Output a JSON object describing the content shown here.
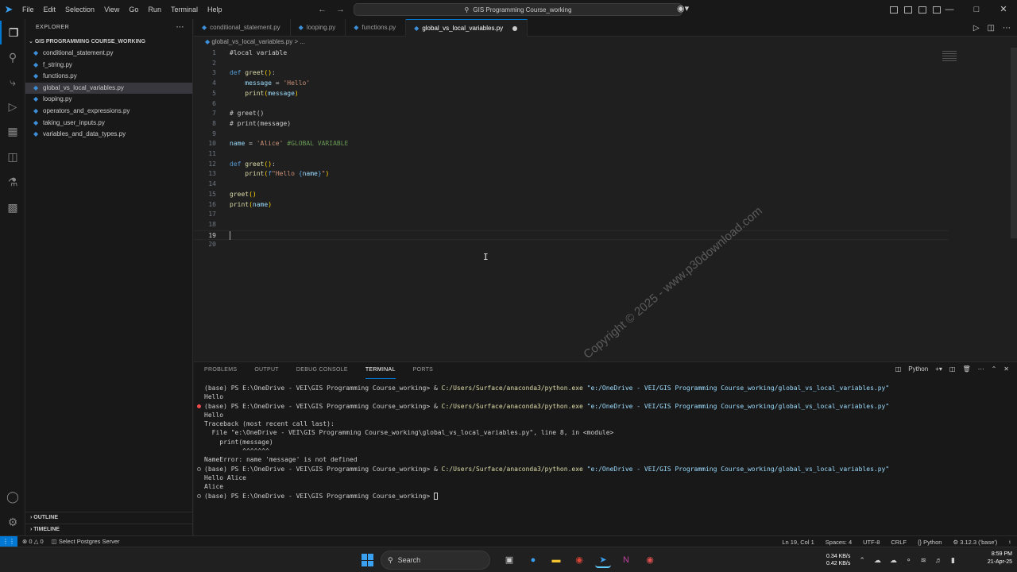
{
  "titlebar": {
    "menu": [
      "File",
      "Edit",
      "Selection",
      "View",
      "Go",
      "Run",
      "Terminal",
      "Help"
    ],
    "search": "GIS Programming Course_working"
  },
  "sidebar": {
    "header": "EXPLORER",
    "folder": "GIS PROGRAMMING COURSE_WORKING",
    "files": [
      "conditional_statement.py",
      "f_string.py",
      "functions.py",
      "global_vs_local_variables.py",
      "looping.py",
      "operators_and_expressions.py",
      "taking_user_inputs.py",
      "variables_and_data_types.py"
    ],
    "selected_index": 3,
    "outline": "OUTLINE",
    "timeline": "TIMELINE"
  },
  "tabs": [
    {
      "label": "conditional_statement.py",
      "active": false
    },
    {
      "label": "looping.py",
      "active": false
    },
    {
      "label": "functions.py",
      "active": false
    },
    {
      "label": "global_vs_local_variables.py",
      "active": true,
      "modified": true
    }
  ],
  "breadcrumb": "global_vs_local_variables.py > ...",
  "editor": {
    "current_line": 19,
    "lines": [
      {
        "n": "1",
        "text": "#local variable"
      },
      {
        "n": "2",
        "text": ""
      },
      {
        "n": "3",
        "text": "def greet():"
      },
      {
        "n": "4",
        "text": "    message = 'Hello'"
      },
      {
        "n": "5",
        "text": "    print(message)"
      },
      {
        "n": "6",
        "text": ""
      },
      {
        "n": "7",
        "text": "# greet()"
      },
      {
        "n": "8",
        "text": "# print(message)"
      },
      {
        "n": "9",
        "text": ""
      },
      {
        "n": "10",
        "text": "name = 'Alice' #GLOBAL VARIABLE"
      },
      {
        "n": "11",
        "text": ""
      },
      {
        "n": "12",
        "text": "def greet():"
      },
      {
        "n": "13",
        "text": "    print(f\"Hello {name}\")"
      },
      {
        "n": "14",
        "text": ""
      },
      {
        "n": "15",
        "text": "greet()"
      },
      {
        "n": "16",
        "text": "print(name)"
      },
      {
        "n": "17",
        "text": ""
      },
      {
        "n": "18",
        "text": ""
      },
      {
        "n": "19",
        "text": ""
      },
      {
        "n": "20",
        "text": ""
      }
    ],
    "watermark": "Copyright © 2025 - www.p30download.com"
  },
  "panel": {
    "tabs": [
      "PROBLEMS",
      "OUTPUT",
      "DEBUG CONSOLE",
      "TERMINAL",
      "PORTS"
    ],
    "active_tab": "TERMINAL",
    "shell_label": "Python",
    "terminal_lines": [
      {
        "marker": "",
        "prompt": "(base) PS E:\\OneDrive - VEI\\GIS Programming Course_working> & ",
        "exe": "C:/Users/Surface/anaconda3/python.exe",
        "path": " \"e:/OneDrive - VEI/GIS Programming Course_working/global_vs_local_variables.py\""
      },
      {
        "marker": "",
        "text": "Hello"
      },
      {
        "marker": "err",
        "prompt": "(base) PS E:\\OneDrive - VEI\\GIS Programming Course_working> & ",
        "exe": "C:/Users/Surface/anaconda3/python.exe",
        "path": " \"e:/OneDrive - VEI/GIS Programming Course_working/global_vs_local_variables.py\""
      },
      {
        "marker": "",
        "text": "Hello"
      },
      {
        "marker": "",
        "text": "Traceback (most recent call last):"
      },
      {
        "marker": "",
        "text": "  File \"e:\\OneDrive - VEI\\GIS Programming Course_working\\global_vs_local_variables.py\", line 8, in <module>"
      },
      {
        "marker": "",
        "text": "    print(message)"
      },
      {
        "marker": "",
        "text": "          ^^^^^^^"
      },
      {
        "marker": "",
        "text": "NameError: name 'message' is not defined"
      },
      {
        "marker": "ok",
        "prompt": "(base) PS E:\\OneDrive - VEI\\GIS Programming Course_working> & ",
        "exe": "C:/Users/Surface/anaconda3/python.exe",
        "path": " \"e:/OneDrive - VEI/GIS Programming Course_working/global_vs_local_variables.py\""
      },
      {
        "marker": "",
        "text": "Hello Alice"
      },
      {
        "marker": "",
        "text": "Alice"
      },
      {
        "marker": "ok",
        "text": "(base) PS E:\\OneDrive - VEI\\GIS Programming Course_working> ",
        "cursor": true
      }
    ]
  },
  "statusbar": {
    "errors": "0",
    "warnings": "0",
    "postgres": "Select Postgres Server",
    "position": "Ln 19, Col 1",
    "spaces": "Spaces: 4",
    "encoding": "UTF-8",
    "eol": "CRLF",
    "language": "Python",
    "interpreter": "3.12.3 ('base')"
  },
  "taskbar": {
    "search": "Search",
    "upload": "0.34 KB/s",
    "download": "0.42 KB/s",
    "time": "8:59 PM",
    "date": "21-Apr-25"
  },
  "colors": {
    "accent": "#0078d4",
    "editor_bg": "#1f1f1f",
    "sidebar_bg": "#181818"
  }
}
